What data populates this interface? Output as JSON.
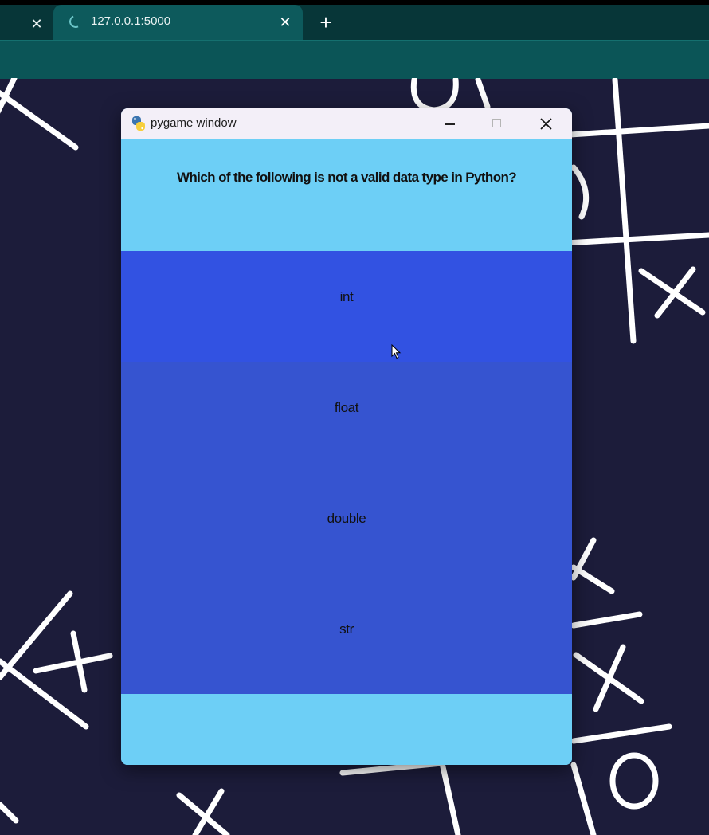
{
  "browser": {
    "tabs": [
      {
        "label": "",
        "close_glyph": "✕"
      },
      {
        "label": "127.0.0.1:5000",
        "close_glyph": "✕",
        "active": true,
        "loading": true
      }
    ],
    "new_tab_glyph": "+"
  },
  "pygame_window": {
    "title": "pygame window",
    "icon": "python-logo-icon",
    "colors": {
      "background": "#6dcff6",
      "option": "#3654d0",
      "option_hover": "#3252e2",
      "text": "#111111"
    }
  },
  "quiz": {
    "question": "Which of the following is not a valid data type in Python?",
    "options": [
      "int",
      "float",
      "double",
      "str"
    ],
    "hovered_option": "int"
  },
  "background": {
    "theme": "tic-tac-toe doodles",
    "color": "#1c1c3a"
  }
}
